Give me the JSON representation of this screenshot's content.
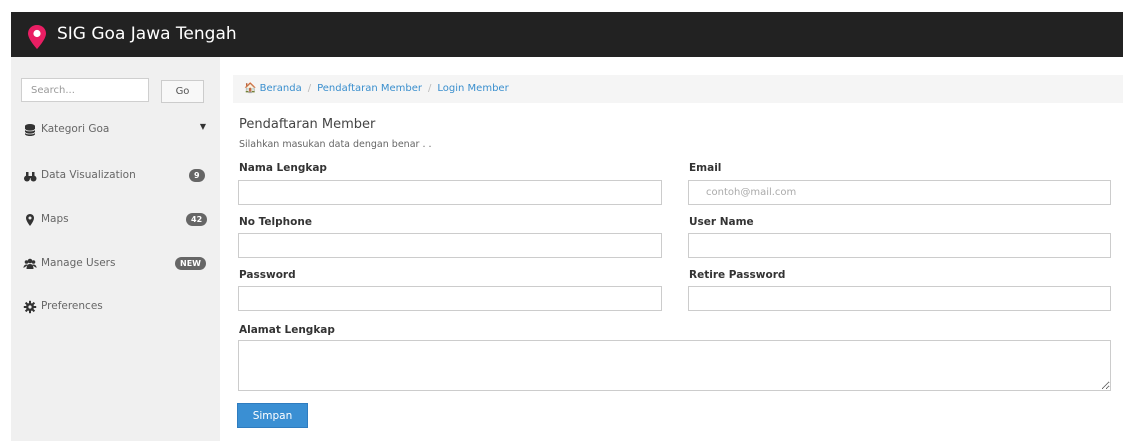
{
  "navbar": {
    "title": "SIG Goa Jawa Tengah",
    "pin_color": "#e91e63"
  },
  "sidebar": {
    "search_placeholder": "Search...",
    "go_label": "Go",
    "items": [
      {
        "label": "Kategori Goa",
        "icon": "database-icon"
      },
      {
        "label": "Data Visualization",
        "icon": "binoculars-icon",
        "badge": "9"
      },
      {
        "label": "Maps",
        "icon": "map-marker-icon",
        "badge": "42"
      },
      {
        "label": "Manage Users",
        "icon": "users-icon",
        "badge": "NEW"
      },
      {
        "label": "Preferences",
        "icon": "gear-icon"
      }
    ]
  },
  "breadcrumb": {
    "home": "Beranda",
    "section": "Pendaftaran Member",
    "current": "Login Member"
  },
  "form": {
    "title": "Pendaftaran Member",
    "subtitle": "Silahkan masukan data dengan benar . .",
    "fields": {
      "nama_label": "Nama Lengkap",
      "email_label": "Email",
      "email_placeholder": "contoh@mail.com",
      "telp_label": "No Telphone",
      "username_label": "User Name",
      "password_label": "Password",
      "retire_password_label": "Retire Password",
      "alamat_label": "Alamat Lengkap"
    },
    "submit_label": "Simpan"
  },
  "colors": {
    "navbar_bg": "#222222",
    "sidebar_bg": "#f0f0f0",
    "link": "#3a8fce",
    "primary_button": "#3a8fd3"
  }
}
